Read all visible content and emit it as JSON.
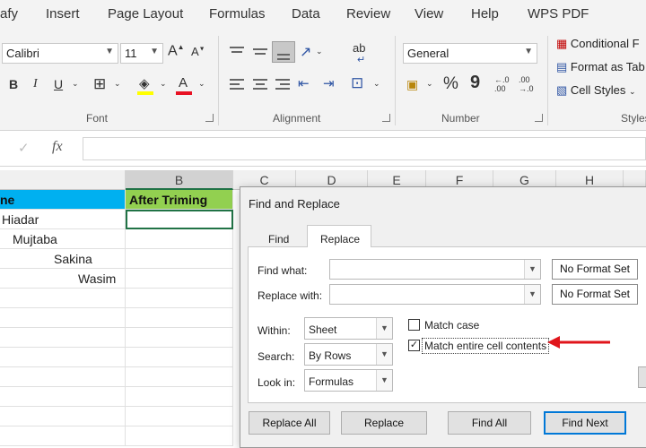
{
  "ribbon_tabs": [
    "afy",
    "Insert",
    "Page Layout",
    "Formulas",
    "Data",
    "Review",
    "View",
    "Help",
    "WPS PDF"
  ],
  "font": {
    "name": "Calibri",
    "size": "11",
    "grow": "A",
    "shrink": "A",
    "bold": "B",
    "italic": "I",
    "underline": "U",
    "font_color_letter": "A",
    "group_label": "Font"
  },
  "alignment": {
    "wrap": "ab",
    "group_label": "Alignment"
  },
  "number": {
    "format": "General",
    "percent": "%",
    "comma": "9",
    "inc_decimal": "←.0\n.00",
    "dec_decimal": ".00\n→.0",
    "group_label": "Number"
  },
  "styles": {
    "items": [
      "Conditional F",
      "Format as Tab",
      "Cell Styles"
    ],
    "group_label": "Styles"
  },
  "formula_bar": {
    "check": "✓",
    "fx": "fx"
  },
  "columns": [
    "B",
    "C",
    "D",
    "E",
    "F",
    "G",
    "H"
  ],
  "cells": {
    "a_header": "ne",
    "b_header": "After Triming",
    "a_values": [
      "Hiadar",
      "Mujtaba",
      "Sakina",
      "Wasim"
    ]
  },
  "dialog": {
    "title": "Find and Replace",
    "tab_find": "Find",
    "tab_replace": "Replace",
    "find_what_label": "Find what:",
    "replace_with_label": "Replace with:",
    "no_format_1": "No Format Set",
    "no_format_2": "No Format Set",
    "within_label": "Within:",
    "within_value": "Sheet",
    "search_label": "Search:",
    "search_value": "By Rows",
    "lookin_label": "Look in:",
    "lookin_value": "Formulas",
    "match_case": "Match case",
    "match_entire": "Match entire cell contents",
    "match_entire_checked": "✓",
    "btn_replace_all": "Replace All",
    "btn_replace": "Replace",
    "btn_find_all": "Find All",
    "btn_find_next": "Find Next"
  },
  "colors": {
    "header_a": "#00b0f0",
    "header_b": "#92d050",
    "arrow": "#e0151b",
    "fill_yellow": "#ffff00",
    "font_red": "#e81123"
  }
}
